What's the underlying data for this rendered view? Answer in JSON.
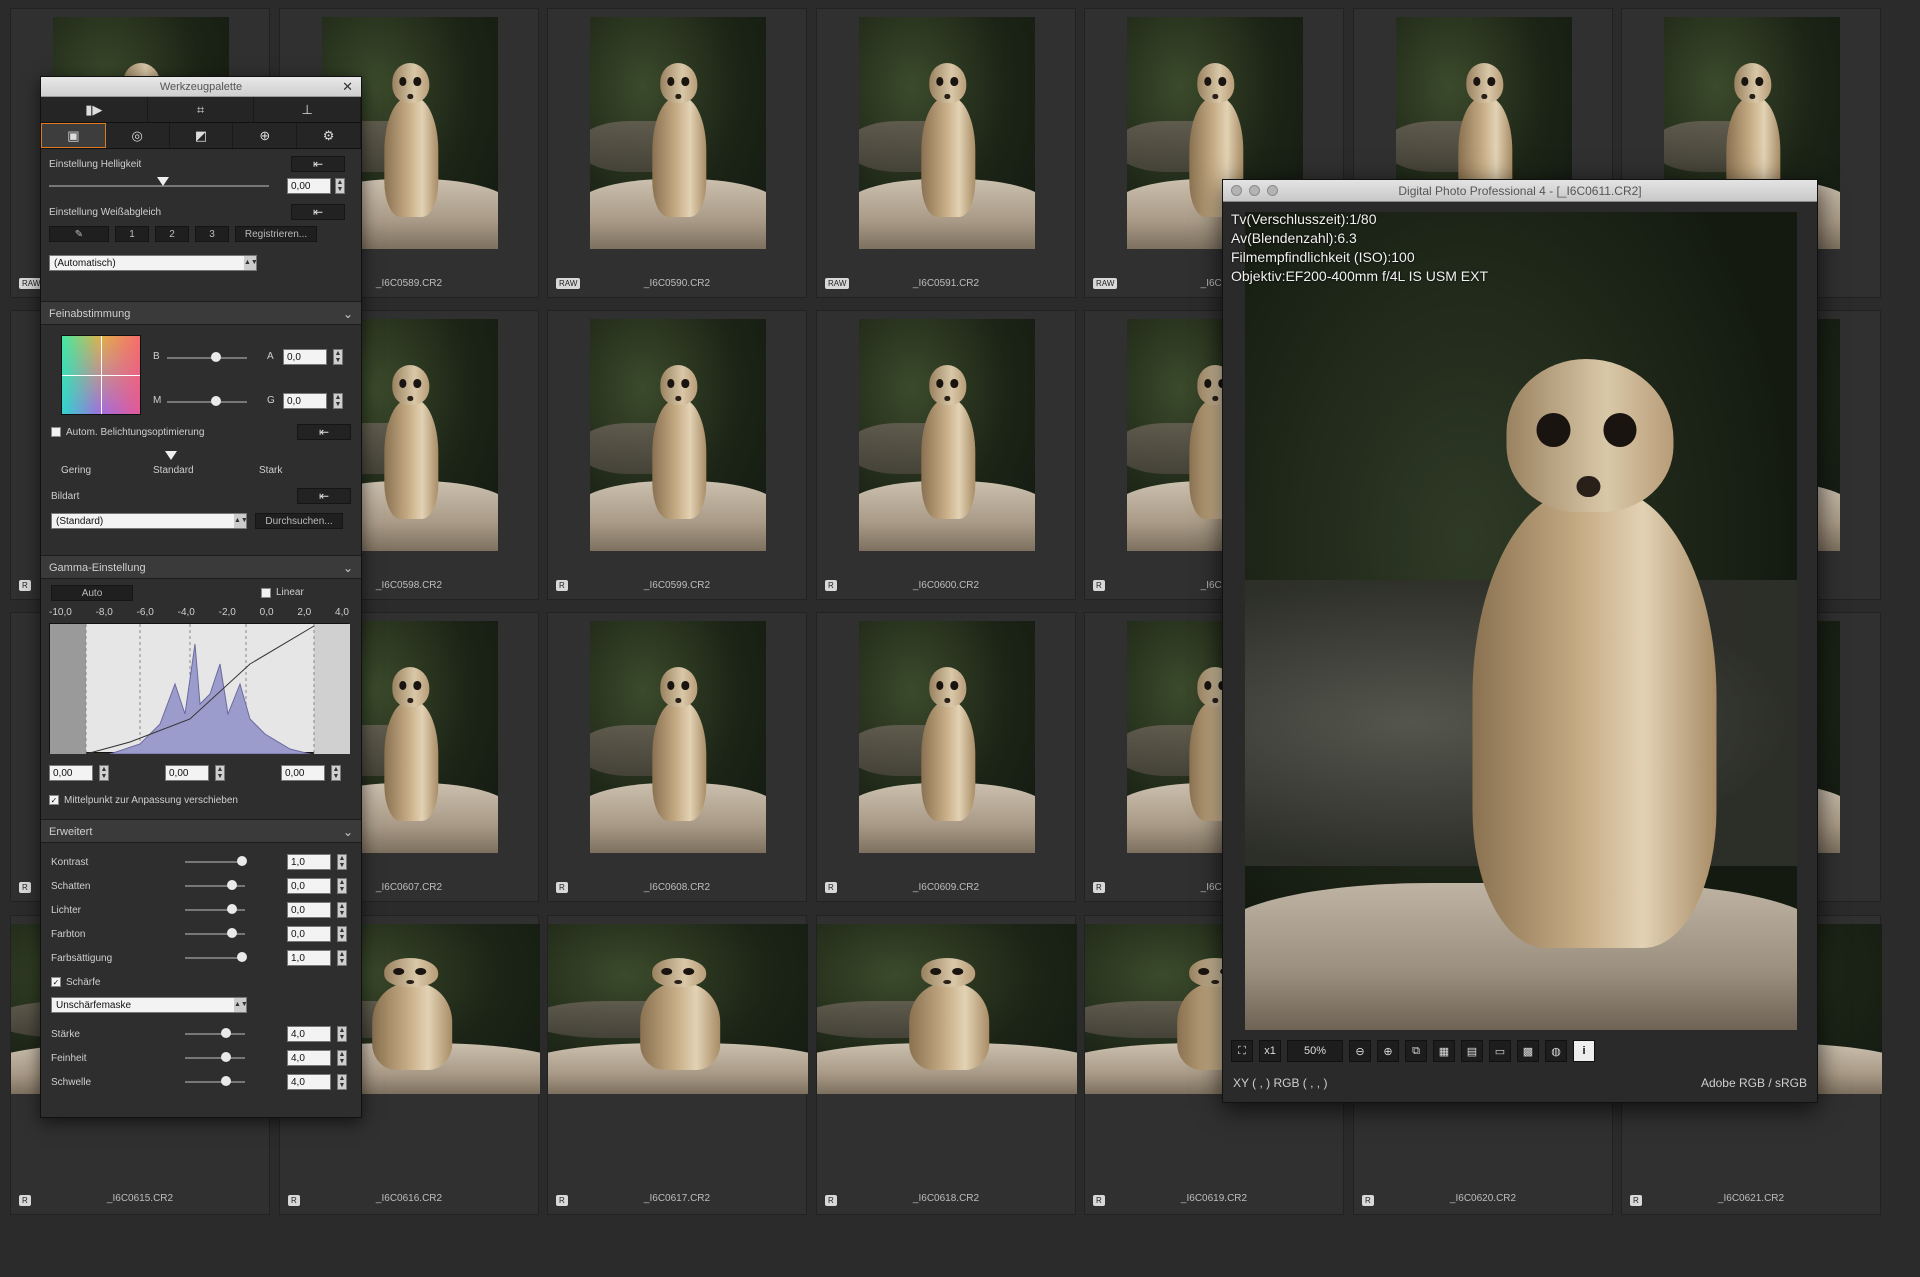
{
  "grid": {
    "rows": [
      {
        "badge": "RAW",
        "files": [
          "",
          "_I6C0589.CR2",
          "_I6C0590.CR2",
          "_I6C0591.CR2",
          "_I6C0",
          "",
          ""
        ]
      },
      {
        "badge": "R",
        "files": [
          "",
          "_I6C0598.CR2",
          "_I6C0599.CR2",
          "_I6C0600.CR2",
          "_I6C0",
          "",
          ""
        ]
      },
      {
        "badge": "R",
        "files": [
          "",
          "_I6C0607.CR2",
          "_I6C0608.CR2",
          "_I6C0609.CR2",
          "_I6C0",
          "",
          ""
        ]
      },
      {
        "badge": "R",
        "files": [
          "_I6C0615.CR2",
          "_I6C0616.CR2",
          "_I6C0617.CR2",
          "_I6C0618.CR2",
          "_I6C0619.CR2",
          "_I6C0620.CR2",
          "_I6C0621.CR2"
        ]
      }
    ]
  },
  "palette": {
    "title": "Werkzeugpalette",
    "close": "✕",
    "top_tabs": [
      "▮▶",
      "⌗",
      "⊥"
    ],
    "tabs": [
      "▣",
      "◎",
      "◩",
      "⊕",
      "⚙"
    ],
    "helligkeit": {
      "label": "Einstellung Helligkeit",
      "value": "0,00",
      "reset": "⇤"
    },
    "weissabgleich": {
      "label": "Einstellung Weißabgleich",
      "reset": "⇤",
      "buttons": [
        "1",
        "2",
        "3"
      ],
      "register": "Registrieren...",
      "select": "(Automatisch)"
    },
    "feinabstimmung": {
      "title": "Feinabstimmung",
      "b": "B",
      "a": "A",
      "m": "M",
      "g": "G",
      "a_value": "0,0",
      "g_value": "0,0"
    },
    "belichtung": {
      "label": "Autom. Belichtungsoptimierung",
      "reset": "⇤",
      "gering": "Gering",
      "standard": "Standard",
      "stark": "Stark"
    },
    "bildart": {
      "label": "Bildart",
      "reset": "⇤",
      "select": "(Standard)",
      "browse": "Durchsuchen..."
    },
    "gamma": {
      "title": "Gamma-Einstellung",
      "auto": "Auto",
      "linear": "Linear",
      "ticks": [
        "-10,0",
        "-8,0",
        "-6,0",
        "-4,0",
        "-2,0",
        "0,0",
        "2,0",
        "4,0"
      ],
      "v1": "0,00",
      "v2": "0,00",
      "v3": "0,00",
      "mittelpunkt": "Mittelpunkt zur Anpassung verschieben"
    },
    "erweitert": {
      "title": "Erweitert",
      "rows": [
        {
          "label": "Kontrast",
          "value": "1,0"
        },
        {
          "label": "Schatten",
          "value": "0,0"
        },
        {
          "label": "Lichter",
          "value": "0,0"
        },
        {
          "label": "Farbton",
          "value": "0,0"
        },
        {
          "label": "Farbsättigung",
          "value": "1,0"
        }
      ],
      "schaerfe": "Schärfe",
      "mask": "Unschärfemaske",
      "sharp_rows": [
        {
          "label": "Stärke",
          "value": "4,0"
        },
        {
          "label": "Feinheit",
          "value": "4,0"
        },
        {
          "label": "Schwelle",
          "value": "4,0"
        }
      ]
    }
  },
  "viewer": {
    "title": "Digital Photo Professional 4 - [_I6C0611.CR2]",
    "exif": [
      "Tv(Verschlusszeit):1/80",
      "Av(Blendenzahl):6.3",
      "Filmempfindlichkeit (ISO):100",
      "Objektiv:EF200-400mm f/4L IS USM EXT"
    ],
    "toolbar": {
      "fit": "⛶",
      "x1": "x1",
      "zoom": "50%",
      "zoom_out": "⊖",
      "zoom_in": "⊕",
      "info": "i"
    },
    "status": {
      "xy": "XY (        ,        )  RGB (        ,        ,        )",
      "profile": "Adobe RGB / sRGB"
    }
  }
}
